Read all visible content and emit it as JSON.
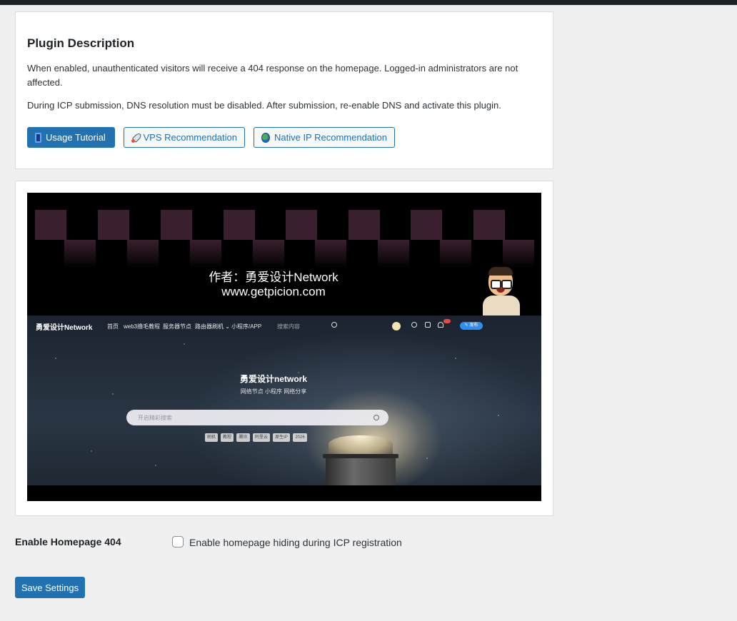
{
  "description": {
    "title": "Plugin Description",
    "paragraph1": "When enabled, unauthenticated visitors will receive a 404 response on the homepage. Logged-in administrators are not affected.",
    "paragraph2": "During ICP submission, DNS resolution must be disabled. After submission, re-enable DNS and activate this plugin.",
    "buttons": {
      "tutorial": "Usage Tutorial",
      "vps": "VPS Recommendation",
      "native_ip": "Native IP Recommendation"
    }
  },
  "video": {
    "author_line": "作者：勇爱设计Network",
    "url_line": "www.getpicion.com",
    "site": {
      "logo": "勇爱设计Network",
      "nav": [
        "首页",
        "web3撸毛教程",
        "服务器节点",
        "路由器刷机 ⌄",
        "小程序/APP"
      ],
      "search_placeholder": "搜索内容",
      "publish": "✎ 发布",
      "hero_title": "勇爱设计network",
      "hero_subtitle": "网络节点 小程序 网络分享",
      "hero_search_placeholder": "开启精彩搜索",
      "tags": [
        "刷机",
        "教程",
        "腾讯",
        "阿里云",
        "原生IP",
        "2026"
      ]
    }
  },
  "form": {
    "label": "Enable Homepage 404",
    "checkbox_label": "Enable homepage hiding during ICP registration",
    "checkbox_checked": false,
    "save_label": "Save Settings"
  },
  "colors": {
    "primary": "#2271b1",
    "background": "#f0f0f1",
    "topbar": "#1d2327"
  }
}
